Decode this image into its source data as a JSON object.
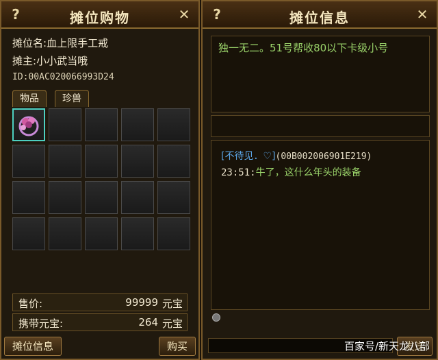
{
  "left_panel": {
    "title": "摊位购物",
    "help_glyph": "?",
    "close_glyph": "✕",
    "stall_name_label": "摊位名:",
    "stall_name": "血上限手工戒",
    "owner_label": "摊主:",
    "owner": "小小武当哦",
    "id_text": "ID:00AC020066993D24",
    "tabs": [
      {
        "label": "物品",
        "active": true
      },
      {
        "label": "珍兽",
        "active": false
      }
    ],
    "grid": {
      "rows": 4,
      "cols": 5,
      "filled_slot_index": 0,
      "item_icon": "ring-icon"
    },
    "price_label": "售价:",
    "price_value": "99999",
    "carried_label": "携带元宝:",
    "carried_value": "264",
    "unit": "元宝",
    "btn_stall_info": "摊位信息",
    "btn_buy": "购买"
  },
  "right_panel": {
    "title": "摊位信息",
    "help_glyph": "?",
    "close_glyph": "✕",
    "message": "独一无二。51号帮收80以下卡级小号",
    "chat": {
      "name": "[不待见．",
      "name_icon": "♡",
      "name_close": "]",
      "id": "(00B002006901E219)",
      "time": "23:51:",
      "text": "牛了，这什么年头的装备"
    },
    "send_label": "发送",
    "watermark": "百家号/新天龙八部"
  },
  "colors": {
    "accent_border": "#7a5a2a",
    "chat_green": "#9ad36a",
    "chat_blue": "#5ba6e8",
    "slot_highlight": "#4dd0c0"
  }
}
